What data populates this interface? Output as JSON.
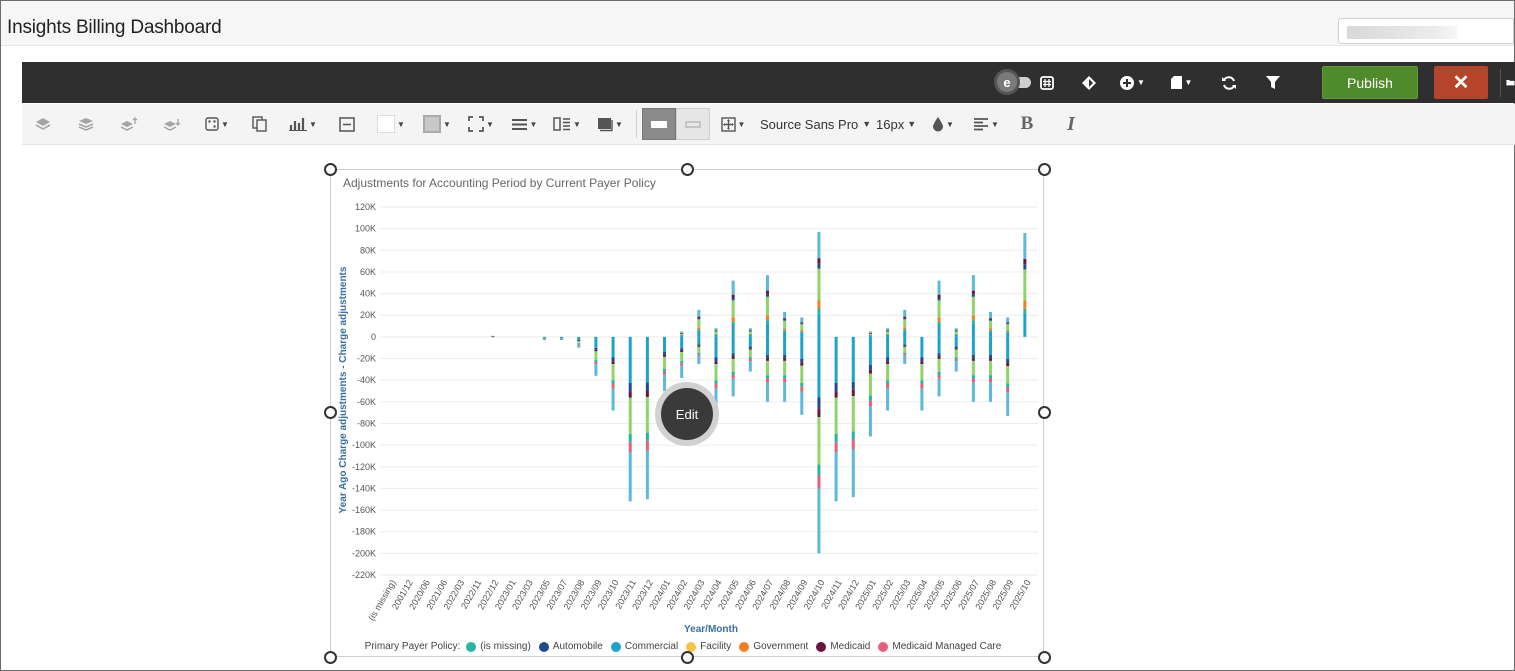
{
  "app": {
    "title": "Insights Billing Dashboard"
  },
  "toolbar": {
    "publish_label": "Publish",
    "close_label": "✕",
    "font_family": "Source Sans Pro",
    "font_size": "16px",
    "bold_label": "B",
    "italic_label": "I",
    "icons": [
      "layers-icon",
      "layers-bottom-icon",
      "layer-up-icon",
      "layer-down-icon",
      "random-icon",
      "duplicate-icon",
      "chart-type-icon",
      "border-icon",
      "fill-color-icon",
      "shadow-icon",
      "fullscreen-icon",
      "row-icon",
      "column-icon",
      "frame-icon",
      "layout-row-icon",
      "layout-row-alt-icon",
      "grid-icon",
      "text-color-icon",
      "align-icon"
    ],
    "dark_icons": [
      "toggle-icon",
      "hash-icon",
      "tag-icon",
      "add-icon",
      "page-icon",
      "refresh-icon",
      "filter-icon",
      "folder-icon"
    ]
  },
  "widget": {
    "edit_label": "Edit"
  },
  "chart_data": {
    "type": "bar",
    "stacked": true,
    "title": "Adjustments for Accounting Period by Current Payer Policy",
    "xlabel": "Year/Month",
    "ylabel": "Year Ago Charge adjustments - Charge adjustments",
    "ylim": [
      -220000,
      120000
    ],
    "y_ticks": [
      "120K",
      "100K",
      "80K",
      "60K",
      "40K",
      "20K",
      "0",
      "-20K",
      "-40K",
      "-60K",
      "-80K",
      "-100K",
      "-120K",
      "-140K",
      "-160K",
      "-180K",
      "-200K",
      "-220K"
    ],
    "categories": [
      "(is missing)",
      "2001/12",
      "2020/06",
      "2021/06",
      "2022/03",
      "2022/11",
      "2022/12",
      "2023/01",
      "2023/03",
      "2023/05",
      "2023/07",
      "2023/08",
      "2023/09",
      "2023/10",
      "2023/11",
      "2023/12",
      "2024/01",
      "2024/02",
      "2024/03",
      "2024/04",
      "2024/05",
      "2024/06",
      "2024/07",
      "2024/08",
      "2024/09",
      "2024/10",
      "2024/11",
      "2024/12",
      "2025/01",
      "2025/02",
      "2025/03",
      "2025/04",
      "2025/05",
      "2025/06",
      "2025/07",
      "2025/08",
      "2025/09",
      "2025/10"
    ],
    "visible_categories": [
      "(is missing)",
      "2001/12",
      "2020/06",
      "2021/06",
      "2022/03",
      "2022/11",
      "2022/12",
      "2023/01",
      "2023/03",
      "2023/05",
      "2023/07",
      "2023/08",
      "2023/09",
      "2023/10",
      "2023/11",
      "2023/12",
      "2024/01",
      "2024/02",
      "2024/03",
      "2024/04",
      "2024/05",
      "2024/06",
      "2024/07",
      "2024/08",
      "2024/09",
      "2024/10",
      "2024/11",
      "2024/12",
      "2025/01",
      "2025/02",
      "2025/03",
      "2025/04",
      "2025/05",
      "2025/06",
      "2025/07",
      "2025/08",
      "2025/09",
      "2025/10"
    ],
    "range_min": [
      0,
      0,
      0,
      0,
      0,
      0,
      0,
      0,
      0,
      -3000,
      -3000,
      -10000,
      -36000,
      -68000,
      -152000,
      -150000,
      -50000,
      -38000,
      -25000,
      -68000,
      -55000,
      -32000,
      -60000,
      -60000,
      -72000,
      -200000,
      -152000,
      -148000,
      -92000,
      -68000,
      -25000,
      -68000,
      -55000,
      -32000,
      -60000,
      -60000,
      -73000,
      0
    ],
    "range_max": [
      0,
      0,
      0,
      0,
      0,
      0,
      1000,
      0,
      0,
      0,
      0,
      0,
      0,
      0,
      0,
      0,
      0,
      5000,
      25000,
      8000,
      52000,
      8000,
      57000,
      23000,
      18000,
      97000,
      0,
      0,
      5000,
      8000,
      25000,
      0,
      52000,
      8000,
      57000,
      23000,
      18000,
      96000
    ],
    "x_range_categories_note": "",
    "legend_title": "Primary Payer Policy:",
    "series": [
      {
        "name": "(is missing)",
        "color": "#26b5a0"
      },
      {
        "name": "Automobile",
        "color": "#1e4d8c"
      },
      {
        "name": "Commercial",
        "color": "#1ca3c9"
      },
      {
        "name": "Facility",
        "color": "#f4c542"
      },
      {
        "name": "Government",
        "color": "#f07f22"
      },
      {
        "name": "Medicaid",
        "color": "#6e1442"
      },
      {
        "name": "Medicaid Managed Care",
        "color": "#e56078"
      }
    ]
  }
}
